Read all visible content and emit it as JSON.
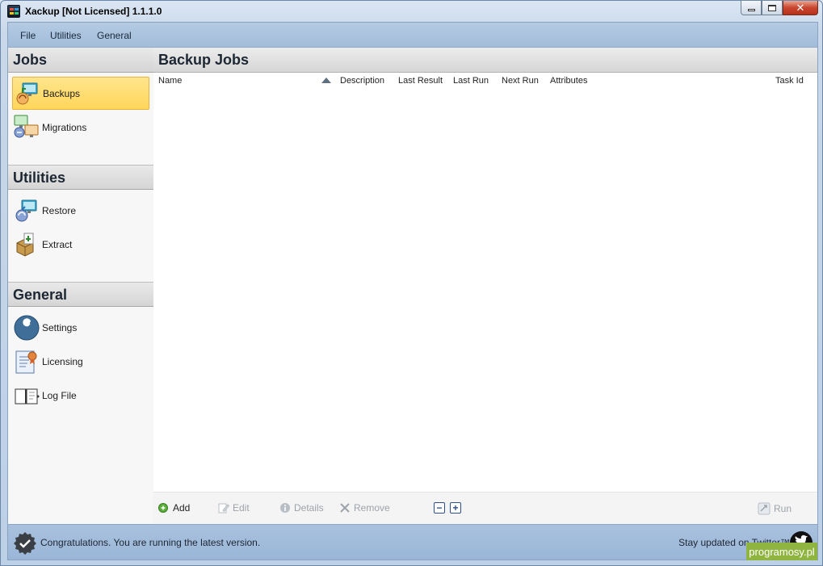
{
  "window": {
    "title": "Xackup [Not Licensed]  1.1.1.0",
    "controls": {
      "minimize": "minimize",
      "maximize": "maximize",
      "close": "✕"
    }
  },
  "menu": [
    "File",
    "Utilities",
    "General"
  ],
  "sidebar": {
    "sections": [
      {
        "title": "Jobs",
        "items": [
          {
            "label": "Backups",
            "icon": "backup-icon",
            "selected": true
          },
          {
            "label": "Migrations",
            "icon": "migration-icon",
            "selected": false
          }
        ]
      },
      {
        "title": "Utilities",
        "items": [
          {
            "label": "Restore",
            "icon": "restore-icon",
            "selected": false
          },
          {
            "label": "Extract",
            "icon": "extract-icon",
            "selected": false
          }
        ]
      },
      {
        "title": "General",
        "items": [
          {
            "label": "Settings",
            "icon": "wrench-icon",
            "selected": false
          },
          {
            "label": "Licensing",
            "icon": "certificate-icon",
            "selected": false
          },
          {
            "label": "Log File",
            "icon": "logbook-icon",
            "selected": false
          }
        ]
      }
    ]
  },
  "main": {
    "title": "Backup Jobs",
    "columns": [
      "Name",
      "Description",
      "Last Result",
      "Last Run",
      "Next Run",
      "Attributes",
      "Task Id"
    ],
    "sort": {
      "column": "Name",
      "direction": "ascending"
    },
    "rows": []
  },
  "toolbar": {
    "add": "Add",
    "edit": "Edit",
    "details": "Details",
    "remove": "Remove",
    "collapse": "−",
    "expand": "+",
    "run": "Run"
  },
  "status": {
    "message": "Congratulations. You are running the latest version.",
    "twitter": "Stay updated on Twitter™"
  },
  "watermark": "programosy.pl",
  "colors": {
    "selected_item": "#ffd65a",
    "menubar": "#a2bcda",
    "statusbar": "#9ab6d7",
    "add_icon": "#5cae3a"
  }
}
